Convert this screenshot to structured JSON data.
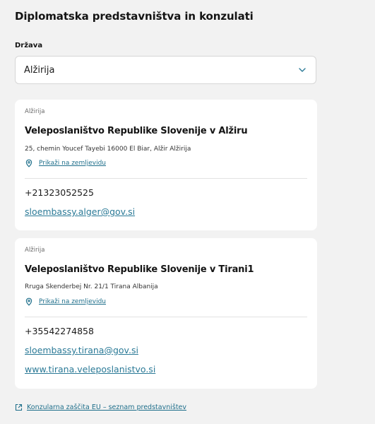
{
  "page": {
    "title": "Diplomatska predstavništva in konzulati"
  },
  "country_select": {
    "label": "Država",
    "value": "Alžirija",
    "icon": "chevron-down-icon"
  },
  "offices": [
    {
      "country": "Alžirija",
      "name": "Veleposlaništvo Republike Slovenije v Alžiru",
      "address": "25, chemin Youcef Tayebi 16000 El Biar, Alžir Alžirija",
      "map_link": "Prikaži na zemljevidu",
      "phone": "+21323052525",
      "email": "sloembassy.alger@gov.si"
    },
    {
      "country": "Alžirija",
      "name": "Veleposlaništvo Republike Slovenije v Tirani1",
      "address": "Rruga Skenderbej Nr. 21/1 Tirana Albanija",
      "map_link": "Prikaži na zemljevidu",
      "phone": "+35542274858",
      "email": "sloembassy.tirana@gov.si",
      "website": "www.tirana.veleposlanistvo.si"
    }
  ],
  "footer_link": {
    "label": "Konzularna zaščita EU – seznam predstavništev",
    "icon": "external-link-icon"
  },
  "colors": {
    "background": "#f2f2f2",
    "card": "#ffffff",
    "link": "#2b7a97"
  }
}
